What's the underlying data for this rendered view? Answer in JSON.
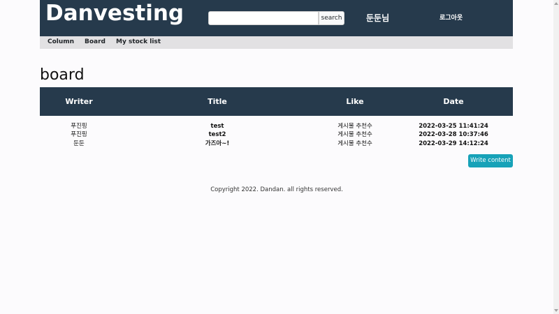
{
  "header": {
    "logo": "Danvesting",
    "search": {
      "value": "",
      "button_label": "search"
    },
    "user_name": "둔둔님",
    "logout_label": "로그아웃"
  },
  "nav": {
    "items": [
      {
        "label": "Column"
      },
      {
        "label": "Board"
      },
      {
        "label": "My stock list"
      }
    ]
  },
  "page": {
    "title": "board"
  },
  "table": {
    "headers": [
      "Writer",
      "Title",
      "Like",
      "Date"
    ],
    "rows": [
      {
        "writer": "푸진핑",
        "title": "test",
        "like": "게시물 추천수",
        "date": "2022-03-25 11:41:24"
      },
      {
        "writer": "푸진핑",
        "title": "test2",
        "like": "게시물 추천수",
        "date": "2022-03-28 10:37:46"
      },
      {
        "writer": "둔둔",
        "title": "가즈아~!",
        "like": "게시물 추천수",
        "date": "2022-03-29 14:12:24"
      }
    ]
  },
  "write_button_label": "Write content",
  "footer": {
    "text": "Copyright 2022. Dandan. all rights reserved."
  },
  "colors": {
    "header_bg": "#263a4c",
    "nav_bg": "#e2e1e3",
    "accent_button": "#17a2b8"
  }
}
